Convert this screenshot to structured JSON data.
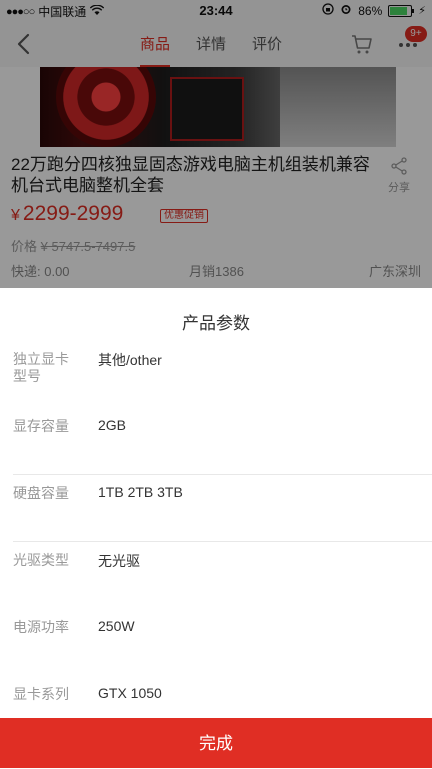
{
  "status_bar": {
    "carrier": "中国联通",
    "time": "23:44",
    "battery_percent": "86%",
    "battery_level": 0.86
  },
  "nav": {
    "tabs": [
      {
        "label": "商品",
        "active": true
      },
      {
        "label": "详情",
        "active": false
      },
      {
        "label": "评价",
        "active": false
      }
    ],
    "badge": "9+"
  },
  "product": {
    "title": "22万跑分四核独显固态游戏电脑主机组装机兼容机台式电脑整机全套",
    "share_label": "分享",
    "currency": "¥",
    "price_range": "2299-2999",
    "promo_tag": "优惠促销",
    "original_price_label": "价格",
    "original_price": "¥ 5747.5-7497.5",
    "shipping": "快递: 0.00",
    "monthly_sales": "月销1386",
    "location": "广东深圳"
  },
  "sheet": {
    "title": "产品参数",
    "params": [
      {
        "label": "独立显卡型号",
        "value": "其他/other"
      },
      {
        "label": "显存容量",
        "value": "2GB"
      },
      {
        "label": "硬盘容量",
        "value": "1TB 2TB 3TB"
      },
      {
        "label": "光驱类型",
        "value": "无光驱"
      },
      {
        "label": "电源功率",
        "value": "250W"
      },
      {
        "label": "显卡系列",
        "value": "GTX 1050"
      }
    ],
    "done_label": "完成"
  },
  "colors": {
    "accent": "#e02e24",
    "overlay": "rgba(0,0,0,0.4)"
  }
}
